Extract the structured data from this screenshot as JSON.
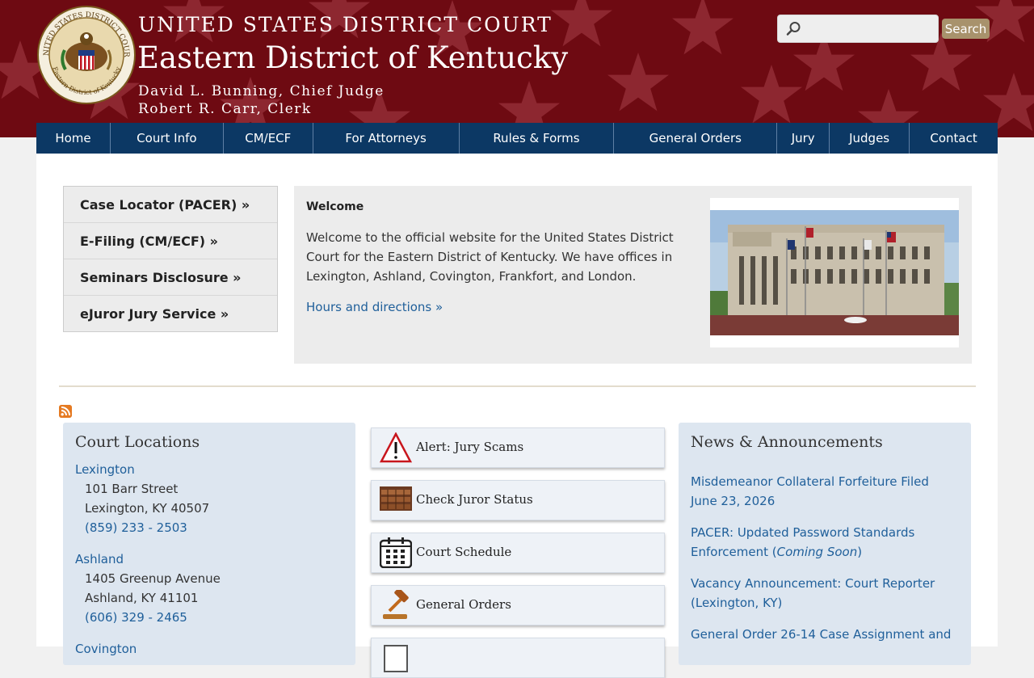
{
  "header": {
    "court_name": "UNITED STATES DISTRICT COURT",
    "district_name": "Eastern District of Kentucky",
    "chief_judge": "David L. Bunning, Chief Judge",
    "clerk": "Robert R. Carr, Clerk",
    "seal_top_text": "UNITED STATES DISTRICT COURT",
    "seal_bottom_text": "Eastern District of Kentucky",
    "search_placeholder": "",
    "search_button": "Search",
    "search_icon": "magnifier-icon",
    "colors": {
      "header_bg": "#6e0a12",
      "star": "#8f2a33",
      "search_button": "#a8926c"
    }
  },
  "nav": {
    "items": [
      "Home",
      "Court Info",
      "CM/ECF",
      "For Attorneys",
      "Rules & Forms",
      "General Orders",
      "Jury",
      "Judges",
      "Contact"
    ],
    "colors": {
      "bg": "#0c3864"
    }
  },
  "quick_links": [
    "Case Locator (PACER) »",
    "E-Filing (CM/ECF) »",
    "Seminars Disclosure »",
    "eJuror Jury Service »"
  ],
  "welcome": {
    "title": "Welcome",
    "text": "Welcome to the official website for the United States District Court for the Eastern District of Kentucky. We have offices in Lexington, Ashland, Covington, Frankfort, and London.",
    "link": "Hours and directions »",
    "image": "courthouse-photo"
  },
  "rss_icon": "rss-icon",
  "locations": {
    "title": "Court Locations",
    "items": [
      {
        "name": "Lexington",
        "street": "101 Barr Street",
        "city": "Lexington, KY 40507",
        "phone": "(859) 233 - 2503"
      },
      {
        "name": "Ashland",
        "street": "1405 Greenup Avenue",
        "city": "Ashland, KY 41101",
        "phone": "(606) 329 - 2465"
      },
      {
        "name": "Covington"
      }
    ]
  },
  "tiles": [
    {
      "label": "Alert: Jury Scams",
      "icon": "warning-icon"
    },
    {
      "label": "Check Juror Status",
      "icon": "jury-box-icon"
    },
    {
      "label": "Court Schedule",
      "icon": "calendar-icon"
    },
    {
      "label": "General Orders",
      "icon": "gavel-icon"
    },
    {
      "label": "",
      "icon": "document-icon"
    }
  ],
  "news": {
    "title": "News & Announcements",
    "items": [
      {
        "text": "Misdemeanor Collateral Forfeiture Filed June 23, 2026"
      },
      {
        "text": "PACER: Updated Password Standards Enforcement (",
        "em": "Coming Soon",
        "after": ")"
      },
      {
        "text": "Vacancy Announcement: Court Reporter (Lexington, KY)"
      },
      {
        "text": "General Order 26-14 Case Assignment and"
      }
    ]
  },
  "colors": {
    "link": "#1f5f9a",
    "panel_bg": "#dde6f0",
    "welcome_bg": "#ececec"
  }
}
